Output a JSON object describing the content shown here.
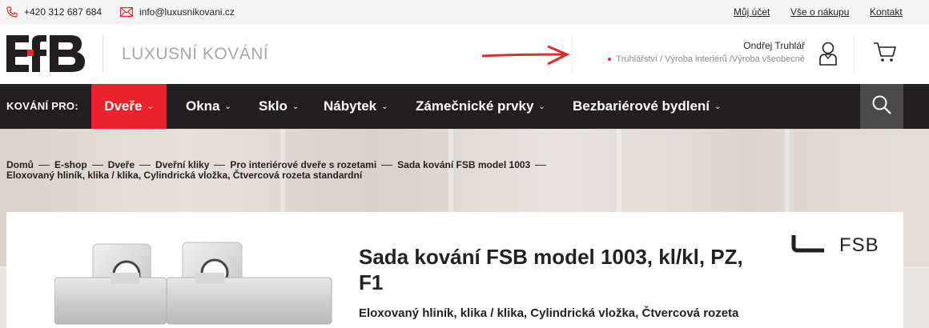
{
  "topbar": {
    "phone": "+420 312 687 684",
    "email": "info@luxusnikovani.cz",
    "links": [
      "Můj účet",
      "Vše o nákupu",
      "Kontakt"
    ]
  },
  "header": {
    "logo_text": "EfB",
    "tagline": "LUXUSNÍ KOVÁNÍ",
    "user_name": "Ondřej Truhlář",
    "user_roles": "Truhlářství / Výroba interiérů /Výroba všeobecně"
  },
  "nav": {
    "label": "KOVÁNÍ PRO:",
    "items": [
      "Dveře",
      "Okna",
      "Sklo",
      "Nábytek",
      "Zámečnické prvky",
      "Bezbariérové bydlení"
    ]
  },
  "breadcrumb": {
    "items": [
      "Domů",
      "E-shop",
      "Dveře",
      "Dveřní kliky",
      "Pro interiérové dveře s rozetami",
      "Sada kování FSB model 1003"
    ],
    "last": "Eloxovaný hliník, klika / klika, Cylindrická vložka, Čtvercová rozeta standardní"
  },
  "product": {
    "title": "Sada kování FSB model 1003, kl/kl, PZ, F1",
    "subtitle": "Eloxovaný hliník, klika / klika, Cylindrická vložka, Čtvercová rozeta",
    "brand": "FSB"
  },
  "colors": {
    "accent": "#e8232b",
    "nav_bg": "#231f20"
  }
}
